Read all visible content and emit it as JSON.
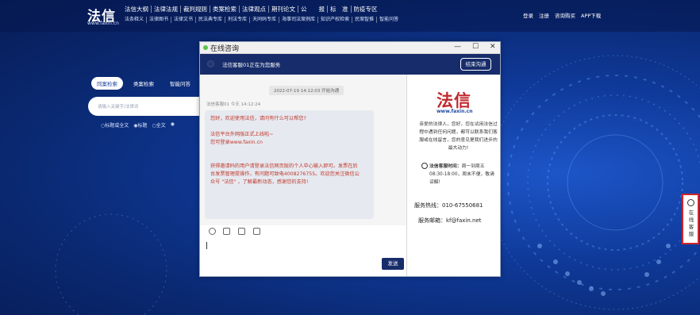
{
  "site": {
    "logo": "法信",
    "logo_sub": "www.faxin.cn",
    "nav_main": [
      "法信大纲",
      "法律法规",
      "裁判规则",
      "类案检索",
      "法律观点",
      "期刊论文",
      "公　　报",
      "标　准",
      "防疫专区"
    ],
    "nav_sub": [
      "法条释义",
      "法律图书",
      "法律文书",
      "民法典专库",
      "刑法专库",
      "天同码专库",
      "海事司法案例库",
      "知识产权检索",
      "民案智推",
      "智能问答"
    ],
    "user_links": [
      "登录",
      "注册",
      "咨询购买",
      "APP下载"
    ],
    "search_tabs": [
      "同案检索",
      "类案检索",
      "智能问答"
    ],
    "search_placeholder": "请输入关键字/法律词",
    "search_options": [
      "○标题或全文",
      "◉标题",
      "○全文",
      "◉"
    ]
  },
  "chat": {
    "window_title": "在线咨询",
    "controls": [
      "—",
      "☐",
      "✕"
    ],
    "agent_status": "法信客服01正在为您服务",
    "end_button": "结束沟通",
    "time_divider": "2022-07-19 14:12:03 开始沟通",
    "sender_meta": "法信客服01 今天 14:12:24",
    "message_lines": [
      "您好，欢迎使用法信，请问有什么可以帮您?",
      "",
      "法信平台外网版正式上线啦~",
      "您可登录www.faxin.cn",
      "",
      "",
      "获得邀请码的用户请登录法信网页版的个人中心输入即可。发票在后",
      "台发票管理提操作，有问题可致电4008276755。欢迎您关注微信公",
      "众号 \"法信\" ，了解最新动态，感谢您的支持!"
    ],
    "toolbar_icons": [
      "emoji-icon",
      "image-icon",
      "folder-icon",
      "screenshot-icon"
    ],
    "send_button": "发送"
  },
  "sidebar": {
    "logo": "法信",
    "url": "www.faxin.cn",
    "intro": "亲爱的法律人，您好，您在试用法信过程中遇到任何问题，都可以联系我们客服或在线留言，您的意见是我们进步的最大动力!",
    "hours_label": "法信客服时间：",
    "hours_text": "周一到周五08:30-18:00，周末不便，敬请谅解!",
    "phone": "服务热线：010-67550681",
    "email": "服务邮箱：kf@faxin.net"
  },
  "float_button": {
    "label": "在线客服"
  },
  "colors": {
    "accent_navy": "#172c6a",
    "message_red": "#c0392b",
    "logo_red": "#c0282d",
    "highlight_border": "#d0262b"
  }
}
